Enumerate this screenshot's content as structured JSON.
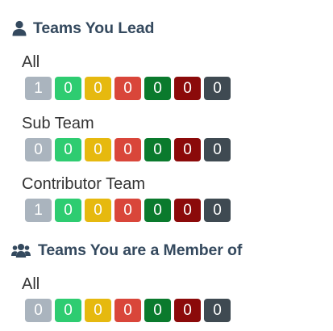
{
  "sections": {
    "lead": {
      "title": "Teams You Lead",
      "icon": "user-icon",
      "teams": [
        {
          "label": "All",
          "counts": [
            "1",
            "0",
            "0",
            "0",
            "0",
            "0",
            "0"
          ]
        },
        {
          "label": "Sub Team",
          "counts": [
            "0",
            "0",
            "0",
            "0",
            "0",
            "0",
            "0"
          ]
        },
        {
          "label": "Contributor Team",
          "counts": [
            "1",
            "0",
            "0",
            "0",
            "0",
            "0",
            "0"
          ]
        }
      ]
    },
    "member": {
      "title": "Teams You are a Member of",
      "icon": "users-icon",
      "teams": [
        {
          "label": "All",
          "counts": [
            "0",
            "0",
            "0",
            "0",
            "0",
            "0",
            "0"
          ]
        }
      ]
    }
  },
  "badge_colors": [
    "#aab4be",
    "#2ecc71",
    "#e6b90f",
    "#d9463a",
    "#0a7a2d",
    "#8b0a0a",
    "#3f4a52"
  ],
  "header_color": "#34495e"
}
